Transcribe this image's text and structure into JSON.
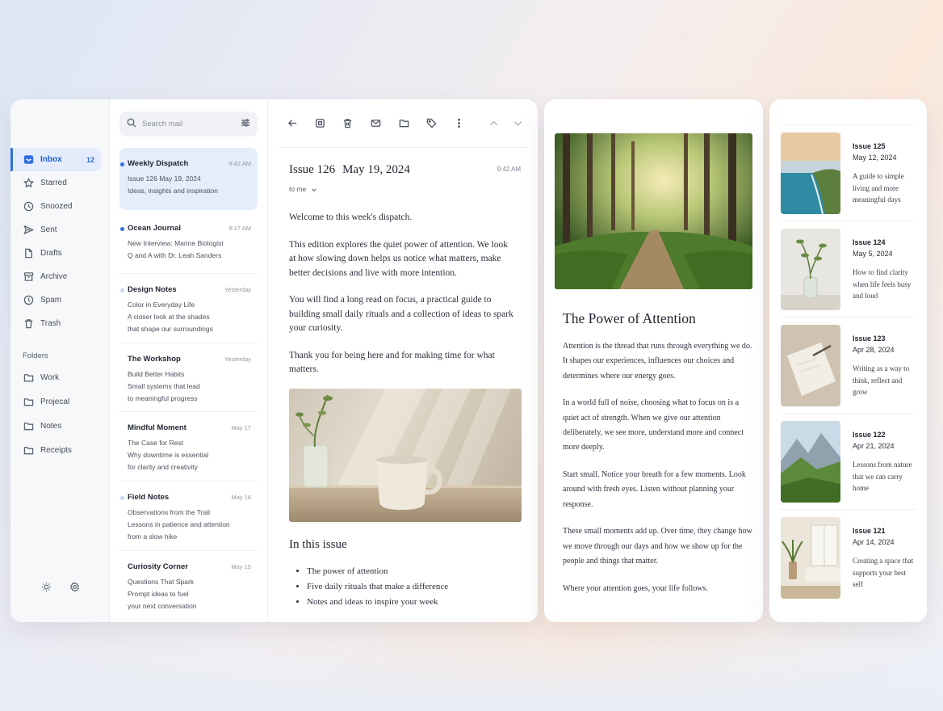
{
  "sidebar": {
    "nav": [
      {
        "label": "Inbox",
        "icon": "inbox-icon",
        "count": "12",
        "active": true
      },
      {
        "label": "Starred",
        "icon": "star-icon"
      },
      {
        "label": "Snoozed",
        "icon": "clock-icon"
      },
      {
        "label": "Sent",
        "icon": "send-icon"
      },
      {
        "label": "Drafts",
        "icon": "file-icon"
      },
      {
        "label": "Archive",
        "icon": "archive-icon"
      },
      {
        "label": "Spam",
        "icon": "clock-icon"
      },
      {
        "label": "Trash",
        "icon": "trash-icon"
      }
    ],
    "folders_heading": "Folders",
    "folders": [
      {
        "label": "Work",
        "icon": "folder-icon"
      },
      {
        "label": "Projecal",
        "icon": "folder-icon"
      },
      {
        "label": "Notes",
        "icon": "folder-icon"
      },
      {
        "label": "Receipts",
        "icon": "folder-icon"
      }
    ]
  },
  "search": {
    "placeholder": "Search mail"
  },
  "messages": [
    {
      "sender": "Weekly Dispatch",
      "time": "9:42 AM",
      "lines": [
        "Issue 126   May 19, 2024",
        "Ideas, insights and inspiration"
      ],
      "unread": true,
      "selected": true
    },
    {
      "sender": "Ocean Journal",
      "time": "8:17 AM",
      "lines": [
        "New Interview: Marine Biologist",
        "Q and A with Dr. Leah Sanders"
      ],
      "unread": true
    },
    {
      "sender": "Design Notes",
      "time": "Yesterday",
      "lines": [
        "Color in Everyday Life",
        "A closer look at the shades",
        "that shape our surroundings"
      ],
      "unread": false
    },
    {
      "sender": "The Workshop",
      "time": "Yesterday",
      "lines": [
        "Build Better Habits",
        "Small systems that lead",
        "to meaningful progress"
      ]
    },
    {
      "sender": "Mindful Moment",
      "time": "May 17",
      "lines": [
        "The Case for Rest",
        "Why downtime is essential",
        "for clarity and creativity"
      ]
    },
    {
      "sender": "Field Notes",
      "time": "May 16",
      "lines": [
        "Observations from the Trail",
        "Lessons in patience and attention",
        "from a slow hike"
      ],
      "unread": false
    },
    {
      "sender": "Curiosity Corner",
      "time": "May 15",
      "lines": [
        "Questions That Spark",
        "Prompt ideas to fuel",
        "your next conversation"
      ]
    }
  ],
  "reader": {
    "issue": "Issue 126",
    "date": "May 19, 2024",
    "time": "9:42 AM",
    "to": "to me",
    "paragraphs": [
      "Welcome to this week's dispatch.",
      "This edition explores the quiet power of attention. We look at how slowing down helps us notice what matters, make better decisions and live with more intention.",
      "You will find a long read on focus, a practical guide to building small daily rituals and a collection of ideas to spark your curiosity.",
      "Thank you for being here and for making time for what matters."
    ],
    "in_this_issue_heading": "In this issue",
    "in_this_issue": [
      "The power of attention",
      "Five daily rituals that make a difference",
      "Notes and ideas to inspire your week"
    ]
  },
  "article": {
    "title": "The Power of Attention",
    "paragraphs": [
      "Attention is the thread that runs through everything we do. It shapes our experiences, influences our choices and determines where our energy goes.",
      "In a world full of noise, choosing what to focus on is a quiet act of strength. When we give our attention deliberately, we see more, understand more and connect more deeply.",
      "Start small. Notice your breath for a few moments. Look around with fresh eyes. Listen without planning your response.",
      "These small moments add up. Over time, they change how we move through our days and how we show up for the people and things that matter.",
      "Where your attention goes, your life follows."
    ]
  },
  "issues": [
    {
      "num": "Issue 125",
      "date": "May 12, 2024",
      "desc": "A guide to simple living and more meaningful days"
    },
    {
      "num": "Issue 124",
      "date": "May 5, 2024",
      "desc": "How to find clarity when life feels busy and loud"
    },
    {
      "num": "Issue 123",
      "date": "Apr 28, 2024",
      "desc": "Writing as a way to think, reflect and grow"
    },
    {
      "num": "Issue 122",
      "date": "Apr 21, 2024",
      "desc": "Lessons from nature that we can carry home"
    },
    {
      "num": "Issue 121",
      "date": "Apr 14, 2024",
      "desc": "Creating a space that supports your best self"
    }
  ],
  "colors": {
    "accent": "#2f6fe0",
    "selected_bg": "#e5edfa"
  }
}
